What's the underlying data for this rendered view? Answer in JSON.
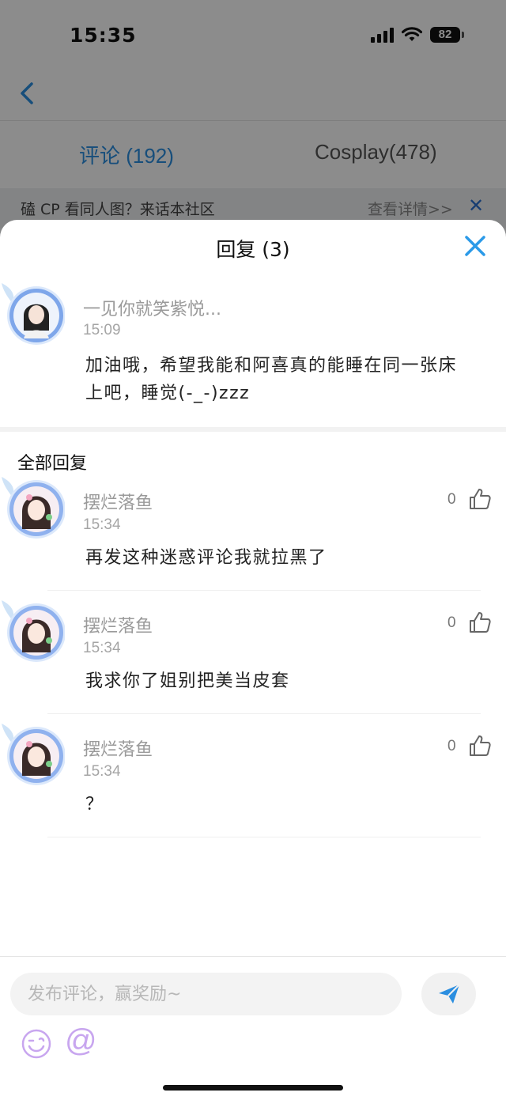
{
  "status_bar": {
    "time": "15:35",
    "battery": "82"
  },
  "tabs": [
    {
      "label": "评论 (192)"
    },
    {
      "label": "Cosplay(478)"
    }
  ],
  "banner": {
    "text": "磕 CP 看同人图？来话本社区",
    "link": "查看详情>>",
    "close": "✕"
  },
  "sheet": {
    "title": "回复 (3)",
    "original_comment": {
      "username": "一见你就笑紫悦...",
      "time": "15:09",
      "content_line1": "加油哦，希望我能和阿喜真的能睡在同一张床",
      "content_line2": "上吧，睡觉(-_-)zzz"
    },
    "section_title": "全部回复",
    "replies": [
      {
        "username": "摆烂落鱼",
        "time": "15:34",
        "content": "再发这种迷惑评论我就拉黑了",
        "likes": "0"
      },
      {
        "username": "摆烂落鱼",
        "time": "15:34",
        "content": "我求你了姐别把美当皮套",
        "likes": "0"
      },
      {
        "username": "摆烂落鱼",
        "time": "15:34",
        "content": "？",
        "likes": "0"
      }
    ]
  },
  "composer": {
    "placeholder": "发布评论，赢奖励~",
    "at_symbol": "@"
  },
  "colors": {
    "accent": "#2b8ee0",
    "close_blue": "#2b9ae8",
    "emoji_purple": "#c8a6ef"
  }
}
